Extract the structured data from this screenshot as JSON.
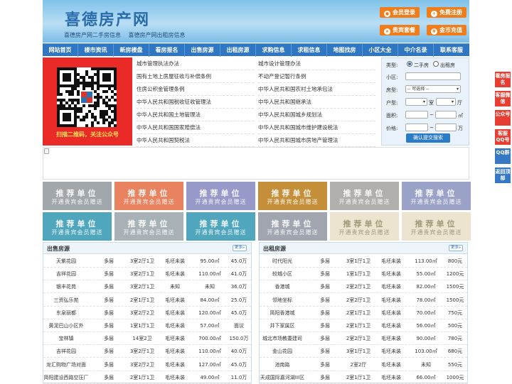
{
  "header": {
    "title": "喜德房产网",
    "subtitle_links": [
      "喜德房产网二手房信息",
      "喜德房产网出租房信息"
    ],
    "buttons": {
      "member_login": "会员登录",
      "free_register": "免费注册",
      "vip_package": "贵宾套餐",
      "recharge": "金币充值"
    }
  },
  "nav": [
    "网站首页",
    "楼市资讯",
    "新房楼盘",
    "看房报名",
    "出售房源",
    "出租房源",
    "求购信息",
    "求租信息",
    "地图找房",
    "小区大全",
    "中介名录",
    "联系客服"
  ],
  "qr": {
    "caption": "扫描二维码，关注公众号"
  },
  "laws_left": [
    "城市管理执法办法",
    "国有土地上房屋征收与补偿条例",
    "住房公积金管理条例",
    "中华人民共和国税收征收管理法",
    "中华人民共和国土地管理法",
    "中华人民共和国国家赔偿法",
    "中华人民共和国契税法"
  ],
  "laws_right": [
    "城市设计管理办法",
    "不动产登记暂行条例",
    "中华人民共和国农村土地承包法",
    "中华人民共和国继承法",
    "中华人民共和国城乡规划法",
    "中华人民共和国城市维护建设税法",
    "中华人民共和国城市房地产管理法"
  ],
  "search": {
    "type_label": "类型:",
    "type_options": [
      "二手房",
      "出租房"
    ],
    "estate_label": "小区:",
    "house_type_label": "房型:",
    "house_type_value": "-- 可选择 --",
    "layout_label": "户型:",
    "room_unit": "室",
    "hall_unit": "厅",
    "area_label": "面积:",
    "area_unit": "㎡",
    "range_sep": "~",
    "price_label": "价格:",
    "price_unit": "万",
    "submit": "确认提交搜索"
  },
  "ads": [
    {
      "t1": "推荐单位",
      "t2": "开通贵宾会员赠送",
      "color": "#a2a7ac"
    },
    {
      "t1": "推荐单位",
      "t2": "开通贵宾会员赠送",
      "color": "#e8825f"
    },
    {
      "t1": "推荐单位",
      "t2": "开通贵宾会员赠送",
      "color": "#9799c9"
    },
    {
      "t1": "推荐单位",
      "t2": "开通贵宾会员赠送",
      "color": "#c58f3a"
    },
    {
      "t1": "推荐单位",
      "t2": "开通贵宾会员赠送",
      "color": "#b0afac"
    },
    {
      "t1": "推荐单位",
      "t2": "开通贵宾会员赠送",
      "color": "#9aa2c8"
    },
    {
      "t1": "推荐单位",
      "t2": "开通贵宾会员赠送",
      "color": "#4fa6bd"
    },
    {
      "t1": "推荐单位",
      "t2": "开通贵宾会员赠送",
      "color": "#a8b2b6"
    },
    {
      "t1": "推荐单位",
      "t2": "开通贵宾会员赠送",
      "color": "#4fa6bd"
    },
    {
      "t1": "推荐单位",
      "t2": "开通贵宾会员赠送",
      "color": "#a0a5b0"
    },
    {
      "t1": "推荐单位",
      "t2": "开通贵宾会员赠送",
      "color": "#ece4cf"
    },
    {
      "t1": "推荐单位",
      "t2": "开通贵宾会员赠送",
      "color": "#ece4cf"
    }
  ],
  "sale": {
    "title": "出售房源",
    "more": "更多»",
    "rows": [
      [
        "天紫花园",
        "多层",
        "3室2厅1卫",
        "毛坯未装",
        "95.00㎡",
        "45.0万"
      ],
      [
        "吉祥花园",
        "多层",
        "3室2厅1卫",
        "毛坯未装",
        "110.00㎡",
        "41.0万"
      ],
      [
        "银丰花苑",
        "多层",
        "3室2厅1卫",
        "未知",
        "未知",
        "36.0万"
      ],
      [
        "三资弘乐苑",
        "多层",
        "2室1厅1卫",
        "毛坯未装",
        "84.00㎡",
        "25.0万"
      ],
      [
        "东泉丽都",
        "多层",
        "3室2厅2卫",
        "毛坯未装",
        "120.00㎡",
        "45.0万"
      ],
      [
        "黄泥巴山小区外",
        "多层",
        "1室1厅1卫",
        "毛坯未装",
        "57.00㎡",
        "面议"
      ],
      [
        "宝林镇",
        "多层",
        "14室2卫",
        "毛坯未装",
        "700.00㎡",
        "150.0万"
      ],
      [
        "吉祥花园",
        "多层",
        "3室2厅1卫",
        "毛坯未装",
        "110.00㎡",
        "40.0万"
      ],
      [
        "龙汇购物广场对面",
        "多层",
        "3室2厅2卫",
        "毛坯未装",
        "127.00㎡",
        "45.0万"
      ],
      [
        "简阳建设西路空压厂",
        "多层",
        "2室1厅1卫",
        "毛坯未装",
        "49.00㎡",
        "11.0万"
      ]
    ]
  },
  "rent": {
    "title": "出租房源",
    "more": "更多»",
    "rows": [
      [
        "时代阳光",
        "多层",
        "3室1厅1卫",
        "毛坯未装",
        "113.00㎡",
        "800元"
      ],
      [
        "较城小区",
        "多层",
        "1室1厅1卫",
        "毛坯未装",
        "55.00㎡",
        "1200元"
      ],
      [
        "香港城",
        "多层",
        "2室2厅1卫",
        "毛坯未装",
        "82.00㎡",
        "1500元"
      ],
      [
        "领地坐标",
        "多层",
        "2室2厅1卫",
        "毛坯未装",
        "78.00㎡",
        "1500元"
      ],
      [
        "简阳香港城",
        "多层",
        "2室1厅1卫",
        "毛坯未装",
        "70.00㎡",
        "750元"
      ],
      [
        "井下家属区",
        "多层",
        "2室1厅1卫",
        "毛坯未装",
        "56.00㎡",
        "500元"
      ],
      [
        "城北市场教委建司",
        "多层",
        "2室2厅1卫",
        "毛坯未装",
        "90.00㎡",
        "780元"
      ],
      [
        "金山花园",
        "多层",
        "3室1厅1卫",
        "毛坯未装",
        "103.00㎡",
        "680元"
      ],
      [
        "池南路",
        "多层",
        "2室2厅",
        "毛坯未装",
        "未知",
        "550元"
      ],
      [
        "天成国际嘉河湖III区",
        "多层",
        "2室1厅1卫",
        "毛坯未装",
        "66.00㎡",
        "1000元"
      ]
    ]
  },
  "side_buttons": [
    {
      "label": "看房报名",
      "color": "#e53e33"
    },
    {
      "label": "客服微信",
      "color": "#e53e33"
    },
    {
      "label": "公众号",
      "color": "#e53e33"
    },
    {
      "label": "客服QQ号",
      "color": "#e53e33"
    },
    {
      "label": "QQ群",
      "color": "#3578c4"
    },
    {
      "label": "返回顶部",
      "color": "#3578c4"
    }
  ]
}
